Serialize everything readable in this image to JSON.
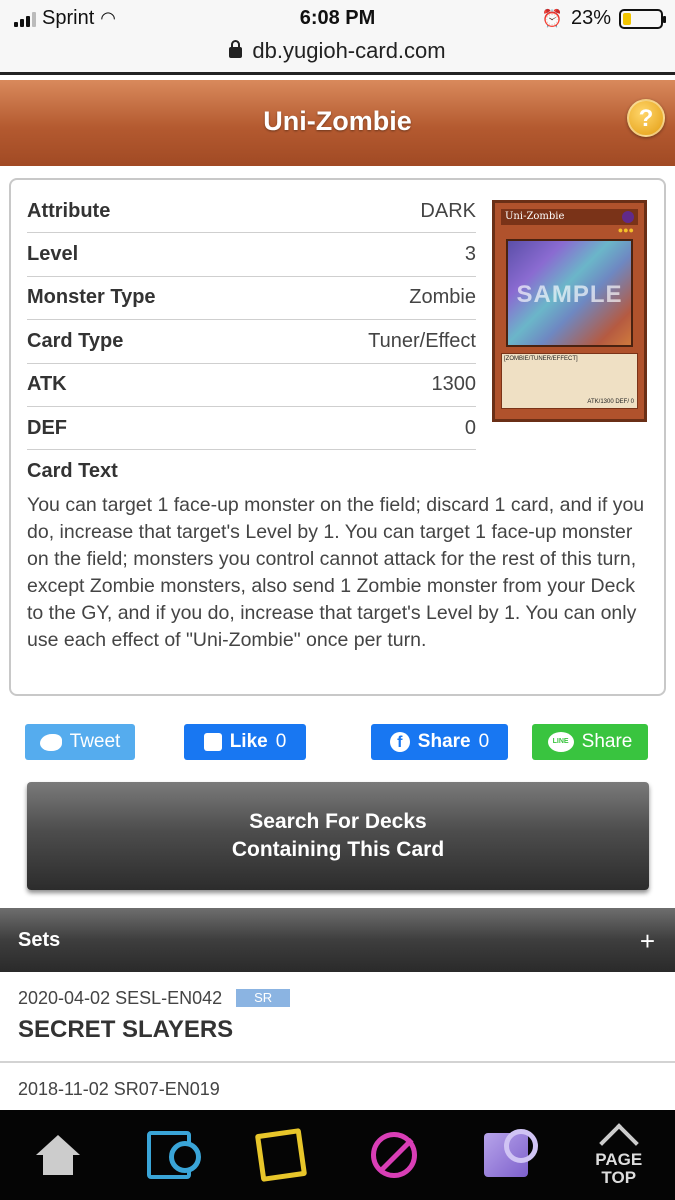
{
  "status_bar": {
    "carrier": "Sprint",
    "time": "6:08 PM",
    "battery": "23%",
    "battery_level": 0.23
  },
  "browser": {
    "url": "db.yugioh-card.com"
  },
  "header": {
    "title": "Uni-Zombie",
    "help_label": "?"
  },
  "card": {
    "rows": [
      {
        "label": "Attribute",
        "value": "DARK"
      },
      {
        "label": "Level",
        "value": "3"
      },
      {
        "label": "Monster Type",
        "value": "Zombie"
      },
      {
        "label": "Card Type",
        "value": "Tuner/Effect"
      },
      {
        "label": "ATK",
        "value": "1300"
      },
      {
        "label": "DEF",
        "value": "0"
      }
    ],
    "image": {
      "name": "Uni-Zombie",
      "watermark": "SAMPLE",
      "type_line": "[ZOMBIE/TUNER/EFFECT]",
      "stats": "ATK/1300  DEF/    0"
    },
    "card_text_label": "Card Text",
    "card_text": "You can target 1 face-up monster on the field; discard 1 card, and if you do, increase that target's Level by 1. You can target 1 face-up monster on the field; monsters you control cannot attack for the rest of this turn, except Zombie monsters, also send 1 Zombie monster from your Deck to the GY, and if you do, increase that target's Level by 1. You can only use each effect of \"Uni-Zombie\" once per turn."
  },
  "social": {
    "tweet_label": "Tweet",
    "like_label": "Like",
    "like_count": "0",
    "share_label": "Share",
    "share_count": "0",
    "line_label": "Share",
    "line_icon_text": "LINE"
  },
  "search_decks": {
    "line1": "Search For Decks",
    "line2": "Containing This Card"
  },
  "sets": {
    "title": "Sets",
    "expand_symbol": "+",
    "items": [
      {
        "date_code": "2020-04-02 SESL-EN042",
        "rarity": "SR",
        "name": "SECRET SLAYERS"
      },
      {
        "date_code": "2018-11-02 SR07-EN019"
      }
    ]
  },
  "bottom_nav": {
    "page_top_label": "PAGE TOP"
  },
  "colors": {
    "header": "#b45a30",
    "tweet": "#55acee",
    "facebook": "#1877f2",
    "line": "#39c43f"
  }
}
